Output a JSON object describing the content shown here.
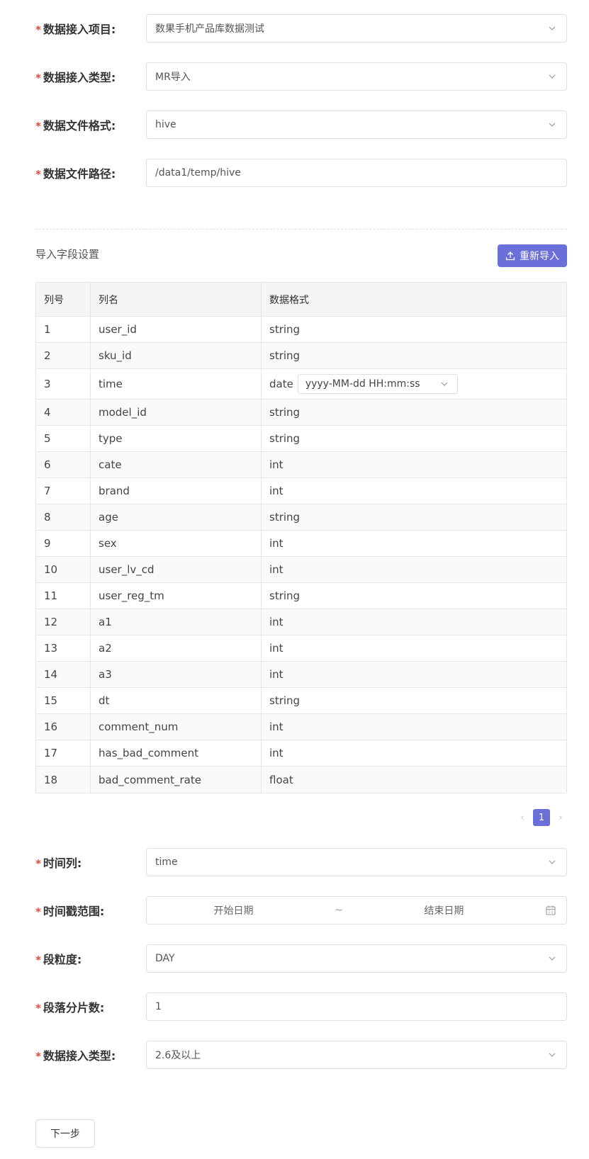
{
  "form_top": {
    "project": {
      "label": "数据接入项目:",
      "value": "数果手机产品库数据测试"
    },
    "ingest_type": {
      "label": "数据接入类型:",
      "value": "MR导入"
    },
    "file_format": {
      "label": "数据文件格式:",
      "value": "hive"
    },
    "file_path": {
      "label": "数据文件路径:",
      "value": "/data1/temp/hive"
    }
  },
  "import_section": {
    "title": "导入字段设置",
    "reimport_label": "重新导入"
  },
  "table": {
    "headers": [
      "列号",
      "列名",
      "数据格式"
    ],
    "rows": [
      {
        "no": "1",
        "name": "user_id",
        "format": "string"
      },
      {
        "no": "2",
        "name": "sku_id",
        "format": "string"
      },
      {
        "no": "3",
        "name": "time",
        "format": "date",
        "date_pattern": "yyyy-MM-dd HH:mm:ss"
      },
      {
        "no": "4",
        "name": "model_id",
        "format": "string"
      },
      {
        "no": "5",
        "name": "type",
        "format": "string"
      },
      {
        "no": "6",
        "name": "cate",
        "format": "int"
      },
      {
        "no": "7",
        "name": "brand",
        "format": "int"
      },
      {
        "no": "8",
        "name": "age",
        "format": "string"
      },
      {
        "no": "9",
        "name": "sex",
        "format": "int"
      },
      {
        "no": "10",
        "name": "user_lv_cd",
        "format": "int"
      },
      {
        "no": "11",
        "name": "user_reg_tm",
        "format": "string"
      },
      {
        "no": "12",
        "name": "a1",
        "format": "int"
      },
      {
        "no": "13",
        "name": "a2",
        "format": "int"
      },
      {
        "no": "14",
        "name": "a3",
        "format": "int"
      },
      {
        "no": "15",
        "name": "dt",
        "format": "string"
      },
      {
        "no": "16",
        "name": "comment_num",
        "format": "int"
      },
      {
        "no": "17",
        "name": "has_bad_comment",
        "format": "int"
      },
      {
        "no": "18",
        "name": "bad_comment_rate",
        "format": "float"
      }
    ]
  },
  "pagination": {
    "current": "1",
    "prev_icon": "chevron-left-icon",
    "next_icon": "chevron-right-icon"
  },
  "form_bottom": {
    "time_column": {
      "label": "时间列:",
      "value": "time"
    },
    "time_range": {
      "label": "时间戳范围:",
      "start_placeholder": "开始日期",
      "separator": "~",
      "end_placeholder": "结束日期"
    },
    "granularity": {
      "label": "段粒度:",
      "value": "DAY"
    },
    "shards": {
      "label": "段落分片数:",
      "value": "1"
    },
    "ingest_type2": {
      "label": "数据接入类型:",
      "value": "2.6及以上"
    }
  },
  "next_button": "下一步",
  "colors": {
    "accent": "#6b6fd9",
    "required": "#e8453c",
    "border": "#dcdfe6"
  }
}
